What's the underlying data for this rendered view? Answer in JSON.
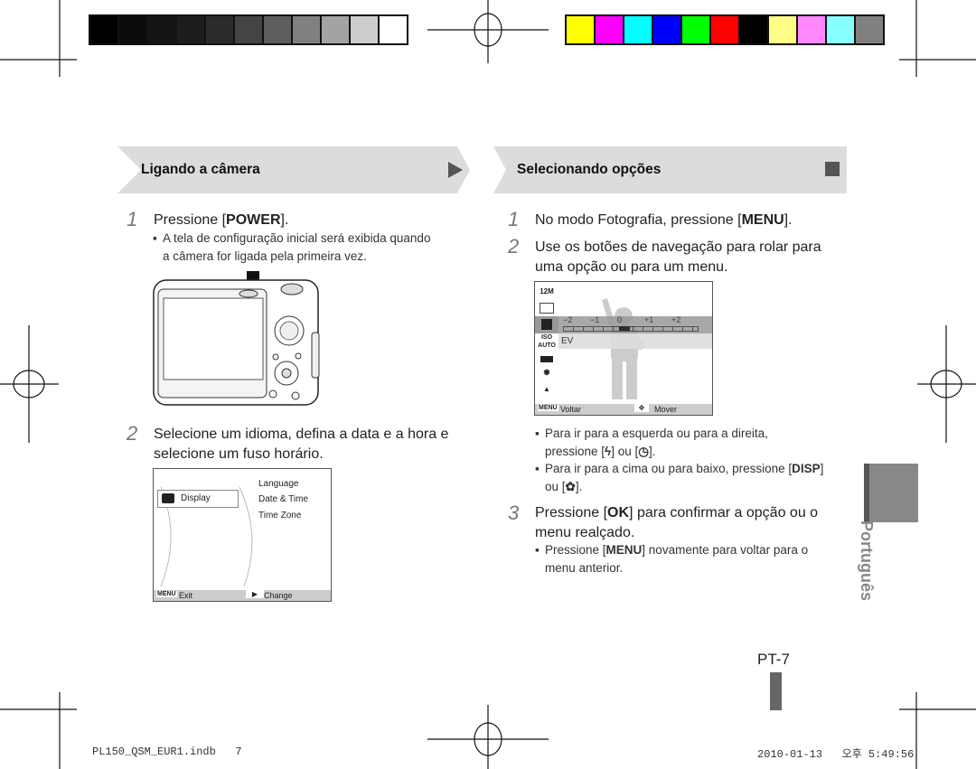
{
  "color_bars": {
    "grayscale": [
      "#000000",
      "#0b0b0b",
      "#141414",
      "#1d1d1d",
      "#2b2b2b",
      "#444444",
      "#5e5e5e",
      "#808080",
      "#a3a3a3",
      "#cccccc",
      "#ffffff"
    ],
    "colors": [
      "#ffff00",
      "#ff00ff",
      "#00ffff",
      "#0000ff",
      "#00ff00",
      "#ff0000",
      "#000000",
      "#ffff88",
      "#ff88ff",
      "#88ffff",
      "#808080"
    ]
  },
  "left": {
    "header": "Ligando a câmera",
    "header_icon": "play-triangle-icon",
    "step1": {
      "num": "1",
      "pre": "Pressione [",
      "key": "POWER",
      "post": "]."
    },
    "step1_bullet_1": "A tela de configuração inicial será exibida quando",
    "step1_bullet_2": "a câmera for ligada pela primeira vez.",
    "step2": {
      "num": "2",
      "line1": "Selecione um idioma, defina a data e a hora e",
      "line2": "selecione um fuso horário."
    },
    "screen": {
      "selected": "Display",
      "options": [
        "Language",
        "Date & Time",
        "Time Zone"
      ],
      "footer_menu": "MENU",
      "footer_exit": "Exit",
      "footer_change": "Change"
    }
  },
  "right": {
    "header": "Selecionando opções",
    "header_icon": "stop-square-icon",
    "step1": {
      "num": "1",
      "pre": "No modo Fotografia, pressione [",
      "key": "MENU",
      "post": "]."
    },
    "step2": {
      "num": "2",
      "line1": "Use os botões de navegação para rolar para",
      "line2": "uma opção ou para um menu."
    },
    "screen": {
      "icons": [
        "12M",
        "quality",
        "EV",
        "ISO AUTO",
        "white balance",
        "face detection off",
        "smart off"
      ],
      "ev_scale": [
        "−2",
        "−1",
        "0",
        "+1",
        "+2"
      ],
      "ev_label": "EV",
      "ev_value": 0,
      "footer_menu": "MENU",
      "footer_back": "Voltar",
      "footer_move": "Mover"
    },
    "bullet1_line1": "Para ir para a esquerda ou para a direita,",
    "bullet1_pre": "pressione [",
    "bullet1_mid": "] ou [",
    "bullet1_post": "].",
    "bullet2_line1_pre": "Para ir para a cima ou para baixo, pressione [",
    "bullet2_key": "DISP",
    "bullet2_line1_post": "]",
    "bullet2_line2_pre": "ou [",
    "bullet2_line2_post": "].",
    "step3": {
      "num": "3",
      "pre": "Pressione [",
      "key": "OK",
      "post": "] para confirmar a opção ou o",
      "line2": "menu realçado."
    },
    "bullet3_pre": "Pressione [",
    "bullet3_key": "MENU",
    "bullet3_post": "] novamente para voltar para o",
    "bullet3_line2": "menu anterior."
  },
  "side_tab": "Português",
  "page_number": "PT-7",
  "footer": {
    "file": "PL150_QSM_EUR1.indb   7",
    "timestamp": "2010-01-13   오후 5:49:56"
  }
}
